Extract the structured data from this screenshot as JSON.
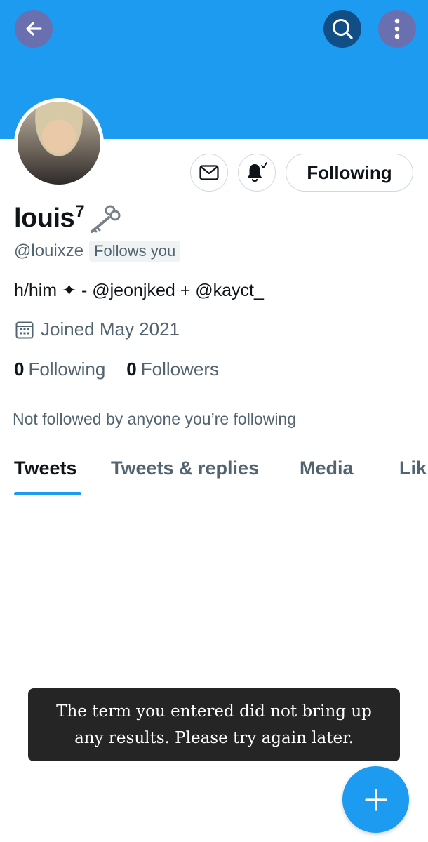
{
  "header": {
    "back_icon": "arrow-left-icon",
    "search_icon": "search-icon",
    "more_icon": "more-vertical-icon",
    "banner_color": "#1d9bf0"
  },
  "profile": {
    "display_name": "louis",
    "name_superscript": "7",
    "name_emoji": "key-icon",
    "handle": "@louixze",
    "follows_you": "Follows you",
    "bio": "h/him ✦  - @jeonjked + @kayct_",
    "joined": "Joined May 2021",
    "following_count": "0",
    "following_label": "Following",
    "followers_count": "0",
    "followers_label": "Followers",
    "not_followed": "Not followed by anyone you’re following"
  },
  "actions": {
    "follow_button": "Following",
    "message_icon": "envelope-icon",
    "notify_icon": "bell-check-icon"
  },
  "tabs": [
    {
      "label": "Tweets",
      "active": true
    },
    {
      "label": "Tweets & replies",
      "active": false
    },
    {
      "label": "Media",
      "active": false
    },
    {
      "label": "Lik",
      "active": false
    }
  ],
  "toast": {
    "message": "The term you entered did not bring up any results. Please try again later."
  },
  "fab": {
    "icon": "plus-icon",
    "color": "#1d9bf0"
  }
}
